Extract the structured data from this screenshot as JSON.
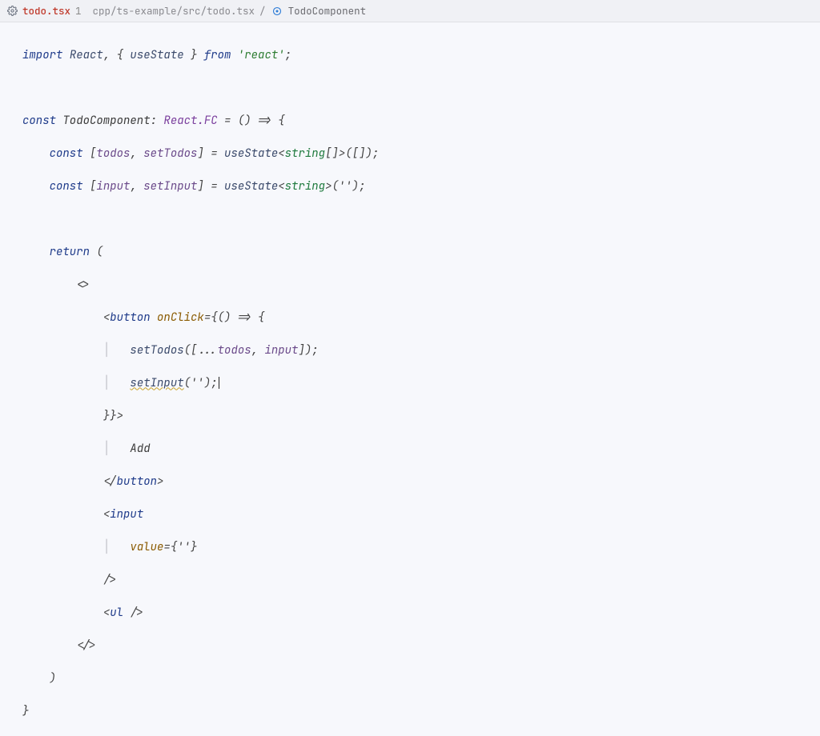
{
  "tab": {
    "filename": "todo.tsx",
    "badge": "1"
  },
  "breadcrumb": {
    "path": "cpp/ts-example/src/todo.tsx",
    "symbol": "TodoComponent"
  },
  "code": {
    "l1_import": "import",
    "l1_react": "React",
    "l1_comma": ",",
    "l1_brace_open": " { ",
    "l1_usestate": "useState",
    "l1_brace_close": " } ",
    "l1_from": "from",
    "l1_str": "'react'",
    "l1_semi": ";",
    "l3_const": "const",
    "l3_name": " TodoComponent",
    "l3_colon": ": ",
    "l3_type": "React.FC",
    "l3_eq_arrow": " = () => {",
    "l4_const": "const",
    "l4_destruct_open": " [",
    "l4_todos": "todos",
    "l4_comma": ", ",
    "l4_setTodos": "setTodos",
    "l4_destruct_close": "] = ",
    "l4_usestate": "useState",
    "l4_lt": "<",
    "l4_string": "string",
    "l4_arr": "[]",
    "l4_gt": ">",
    "l4_call": "([]);",
    "l5_const": "const",
    "l5_destruct_open": " [",
    "l5_input": "input",
    "l5_comma": ", ",
    "l5_setInput": "setInput",
    "l5_destruct_close": "] = ",
    "l5_usestate": "useState",
    "l5_lt": "<",
    "l5_string": "string",
    "l5_gt": ">",
    "l5_call": "('');",
    "l7_return": "return",
    "l7_paren": " (",
    "l8_frag": "<>",
    "l9_open": "<",
    "l9_tag": "button",
    "l9_space": " ",
    "l9_prop": "onClick",
    "l9_eq": "=",
    "l9_brace": "{",
    "l9_arrow": "() => {",
    "l10_call": "setTodos",
    "l10_args_open": "([",
    "l10_spread": "...",
    "l10_todos": "todos",
    "l10_comma": ", ",
    "l10_input": "input",
    "l10_args_close": "]);",
    "l11_call": "setInput",
    "l11_args": "('');",
    "l12_close": "}}>",
    "l13_text": "Add",
    "l14_close_open": "</",
    "l14_tag": "button",
    "l14_gt": ">",
    "l15_open": "<",
    "l15_tag": "input",
    "l16_prop": "value",
    "l16_eq": "=",
    "l16_val": "{''}",
    "l17_close": "/>",
    "l18_open": "<",
    "l18_tag": "ul",
    "l18_close": " />",
    "l19_frag_close": "</>",
    "l20_paren": ")",
    "l21_brace": "}"
  }
}
